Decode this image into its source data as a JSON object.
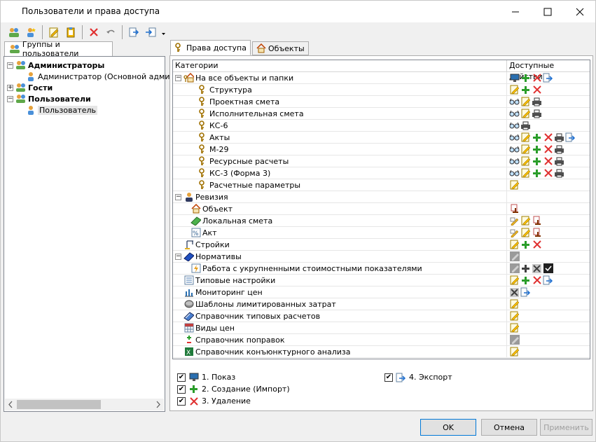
{
  "window": {
    "title": "Пользователи и права доступа"
  },
  "left_tab": {
    "label": "Группы и пользователи"
  },
  "tree": [
    {
      "label": "Администраторы",
      "bold": true,
      "level": 0,
      "expander": "−",
      "icon": "users"
    },
    {
      "label": "Администратор (Основной адми",
      "bold": false,
      "level": 1,
      "expander": "",
      "icon": "user"
    },
    {
      "label": "Гости",
      "bold": true,
      "level": 0,
      "expander": "+",
      "icon": "users"
    },
    {
      "label": "Пользователи",
      "bold": true,
      "level": 0,
      "expander": "−",
      "icon": "users"
    },
    {
      "label": "Пользователь",
      "bold": false,
      "level": 1,
      "expander": "",
      "icon": "user",
      "selected": true
    }
  ],
  "tabs": [
    {
      "label": "Права доступа",
      "active": true,
      "icon": "key"
    },
    {
      "label": "Объекты",
      "active": false,
      "icon": "house"
    }
  ],
  "grid": {
    "col_categories": "Категории",
    "col_actions": "Доступные действия",
    "rows": [
      {
        "label": "На все объекты и папки",
        "indent": 0,
        "expander": "−",
        "icon": "key-house",
        "actions": [
          "monitor",
          "plus",
          "x",
          "export"
        ]
      },
      {
        "label": "Структура",
        "indent": 2,
        "icon": "key",
        "actions": [
          "edit",
          "plus",
          "x"
        ]
      },
      {
        "label": "Проектная смета",
        "indent": 2,
        "icon": "key",
        "actions": [
          "glasses",
          "edit",
          "print"
        ]
      },
      {
        "label": "Исполнительная смета",
        "indent": 2,
        "icon": "key",
        "actions": [
          "glasses",
          "edit",
          "print"
        ]
      },
      {
        "label": "КС-6",
        "indent": 2,
        "icon": "key",
        "actions": [
          "glasses",
          "print"
        ]
      },
      {
        "label": "Акты",
        "indent": 2,
        "icon": "key",
        "actions": [
          "glasses",
          "edit",
          "plus",
          "x",
          "print",
          "export"
        ]
      },
      {
        "label": "М-29",
        "indent": 2,
        "icon": "key",
        "actions": [
          "glasses",
          "edit",
          "plus",
          "x",
          "print"
        ]
      },
      {
        "label": "Ресурсные расчеты",
        "indent": 2,
        "icon": "key",
        "actions": [
          "glasses",
          "edit",
          "plus",
          "x",
          "print"
        ]
      },
      {
        "label": "КС-3 (Форма 3)",
        "indent": 2,
        "icon": "key",
        "actions": [
          "glasses",
          "edit",
          "plus",
          "x",
          "print"
        ]
      },
      {
        "label": "Расчетные параметры",
        "indent": 2,
        "icon": "key",
        "actions": [
          "edit"
        ]
      },
      {
        "label": "Ревизия",
        "indent": 0,
        "expander": "−",
        "icon": "person",
        "actions": []
      },
      {
        "label": "Объект",
        "indent": 1,
        "icon": "house",
        "actions": [
          "stamp"
        ]
      },
      {
        "label": "Локальная смета",
        "indent": 1,
        "icon": "book",
        "actions": [
          "pen",
          "edit",
          "stamp"
        ]
      },
      {
        "label": "Акт",
        "indent": 1,
        "icon": "percent",
        "actions": [
          "pen",
          "edit",
          "stamp"
        ]
      },
      {
        "label": "Стройки",
        "indent": 0,
        "icon": "crane",
        "actions": [
          "edit",
          "plus",
          "x"
        ]
      },
      {
        "label": "Нормативы",
        "indent": 0,
        "expander": "−",
        "icon": "bluebook",
        "actions": [
          "edit-gray"
        ]
      },
      {
        "label": "Работа с укрупненными стоимостными показателями",
        "indent": 1,
        "icon": "doc-lightning",
        "actions": [
          "edit-gray",
          "plus-dark",
          "x-dark",
          "check-dark"
        ]
      },
      {
        "label": "Типовые настройки",
        "indent": 0,
        "icon": "list",
        "actions": [
          "edit",
          "plus",
          "x",
          "export"
        ]
      },
      {
        "label": "Мониторинг цен",
        "indent": 0,
        "icon": "chart",
        "actions": [
          "x-dark",
          "export"
        ]
      },
      {
        "label": "Шаблоны лимитированных затрат",
        "indent": 0,
        "icon": "disk",
        "actions": [
          "edit"
        ]
      },
      {
        "label": "Справочник типовых расчетов",
        "indent": 0,
        "icon": "notebook",
        "actions": [
          "edit"
        ]
      },
      {
        "label": "Виды цен",
        "indent": 0,
        "icon": "table",
        "actions": [
          "edit"
        ]
      },
      {
        "label": "Справочник поправок",
        "indent": 0,
        "icon": "plusminus",
        "actions": [
          "edit-gray"
        ]
      },
      {
        "label": "Справочник конъюнктурного анализа",
        "indent": 0,
        "icon": "excel",
        "actions": [
          "edit"
        ]
      }
    ]
  },
  "legend": [
    {
      "label": "1. Показ",
      "checked": true,
      "icon": "monitor"
    },
    {
      "label": "2. Создание (Импорт)",
      "checked": true,
      "icon": "plus"
    },
    {
      "label": "3. Удаление",
      "checked": true,
      "icon": "x"
    },
    {
      "label": "4. Экспорт",
      "checked": true,
      "icon": "export"
    }
  ],
  "buttons": {
    "ok": "OK",
    "cancel": "Отмена",
    "apply": "Применить"
  },
  "colors": {
    "accent": "#0078d7",
    "green": "#2a9d2a",
    "red": "#e03030"
  }
}
